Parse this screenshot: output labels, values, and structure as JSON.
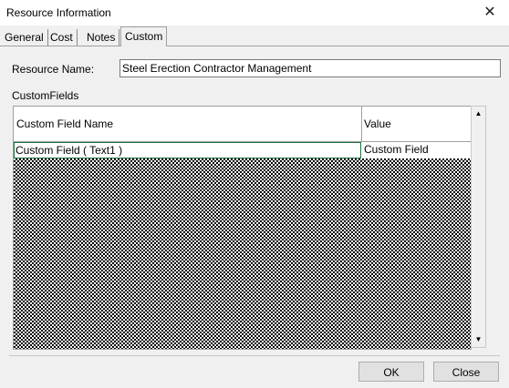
{
  "window": {
    "title": "Resource Information",
    "close_glyph": "✕"
  },
  "tabs": [
    {
      "label": "General"
    },
    {
      "label": "Cost"
    },
    {
      "label": "Notes"
    },
    {
      "label": "Custom",
      "active": true
    }
  ],
  "form": {
    "resource_name_label": "Resource Name:",
    "resource_name_value": "Steel Erection Contractor Management"
  },
  "custom_fields": {
    "section_label": "CustomFields",
    "columns": [
      "Custom Field Name",
      "Value"
    ],
    "rows": [
      {
        "name": "Custom Field ( Text1 )",
        "value": "Custom Field"
      }
    ]
  },
  "scrollbar": {
    "up_glyph": "▲",
    "down_glyph": "▼"
  },
  "buttons": {
    "ok": "OK",
    "close": "Close"
  }
}
